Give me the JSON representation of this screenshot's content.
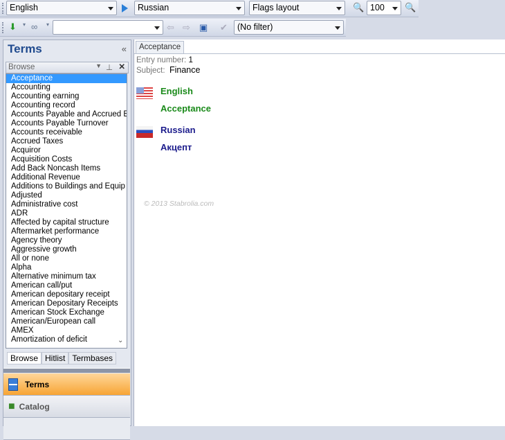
{
  "toolbar1": {
    "source_language": "English",
    "target_language": "Russian",
    "layout": "Flags layout",
    "zoom": "100"
  },
  "toolbar2": {
    "search_value": "",
    "filter": "(No filter)"
  },
  "panel": {
    "title": "Terms",
    "collapse": "«",
    "browse_header": "Browse",
    "items": [
      "Acceptance",
      "Accounting",
      "Accounting earning",
      "Accounting record",
      "Accounts Payable and Accrued E",
      "Accounts Payable Turnover",
      "Accounts receivable",
      "Accrued Taxes",
      "Acquiror",
      "Acquisition Costs",
      "Add Back Noncash Items",
      "Additional Revenue",
      "Additions to Buildings and Equip",
      "Adjusted",
      "Administrative cost",
      "ADR",
      "Affected by capital structure",
      "Aftermarket performance",
      "Agency theory",
      "Aggressive growth",
      "All or none",
      "Alpha",
      "Alternative minimum tax",
      "American call/put",
      "American depositary receipt",
      "American Depositary Receipts",
      "American Stock Exchange",
      "American/European call",
      "AMEX",
      "Amortization of deficit"
    ],
    "tabs": [
      "Browse",
      "Hitlist",
      "Termbases"
    ],
    "nav": [
      "Terms",
      "Catalog"
    ]
  },
  "content": {
    "tab": "Acceptance",
    "entry_label": "Entry number:",
    "entry_value": "1",
    "subject_label": "Subject:",
    "subject_value": "Finance",
    "lang1": "English",
    "term1": "Acceptance",
    "lang2": "Russian",
    "term2": "Акцепт",
    "copyright": "© 2013 Stabrolia.com"
  },
  "colors": {
    "english": "#1a8a1a",
    "russian": "#1c1c8c",
    "selected": "#3399ff",
    "active_nav": "#f9b24a"
  }
}
